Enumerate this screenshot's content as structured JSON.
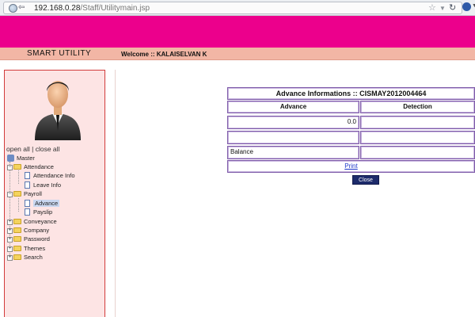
{
  "browser": {
    "url_host": "192.168.0.28",
    "url_path": "/Staff/Utilitymain.jsp"
  },
  "header": {
    "app_title": "SMART UTILITY",
    "welcome": "Welcome :: KALAISELVAN K"
  },
  "sidebar": {
    "open_all": "open all",
    "separator": " | ",
    "close_all": "close all",
    "tree": [
      {
        "label": "Master",
        "level": 0
      },
      {
        "label": "Attendance",
        "level": 0,
        "expanded": true
      },
      {
        "label": "Attendance Info",
        "level": 1
      },
      {
        "label": "Leave Info",
        "level": 1
      },
      {
        "label": "Payroll",
        "level": 0,
        "expanded": true
      },
      {
        "label": "Advance",
        "level": 1,
        "selected": true
      },
      {
        "label": "Payslip",
        "level": 1
      },
      {
        "label": "Conveyance",
        "level": 0
      },
      {
        "label": "Company",
        "level": 0
      },
      {
        "label": "Password",
        "level": 0
      },
      {
        "label": "Themes",
        "level": 0
      },
      {
        "label": "Search",
        "level": 0
      }
    ]
  },
  "advance": {
    "title": "Advance Informations :: CISMAY2012004464",
    "col_advance": "Advance",
    "col_detection": "Detection",
    "row1_value": "0.0",
    "balance_label": "Balance",
    "print_label": "Print",
    "close_label": "Close"
  },
  "colors": {
    "banner": "#ec008c",
    "nav_strip": "#f2b6a5",
    "sidebar_bg": "#fde4e4",
    "table_border": "#7d5aa8",
    "close_button": "#1d2b6b"
  }
}
